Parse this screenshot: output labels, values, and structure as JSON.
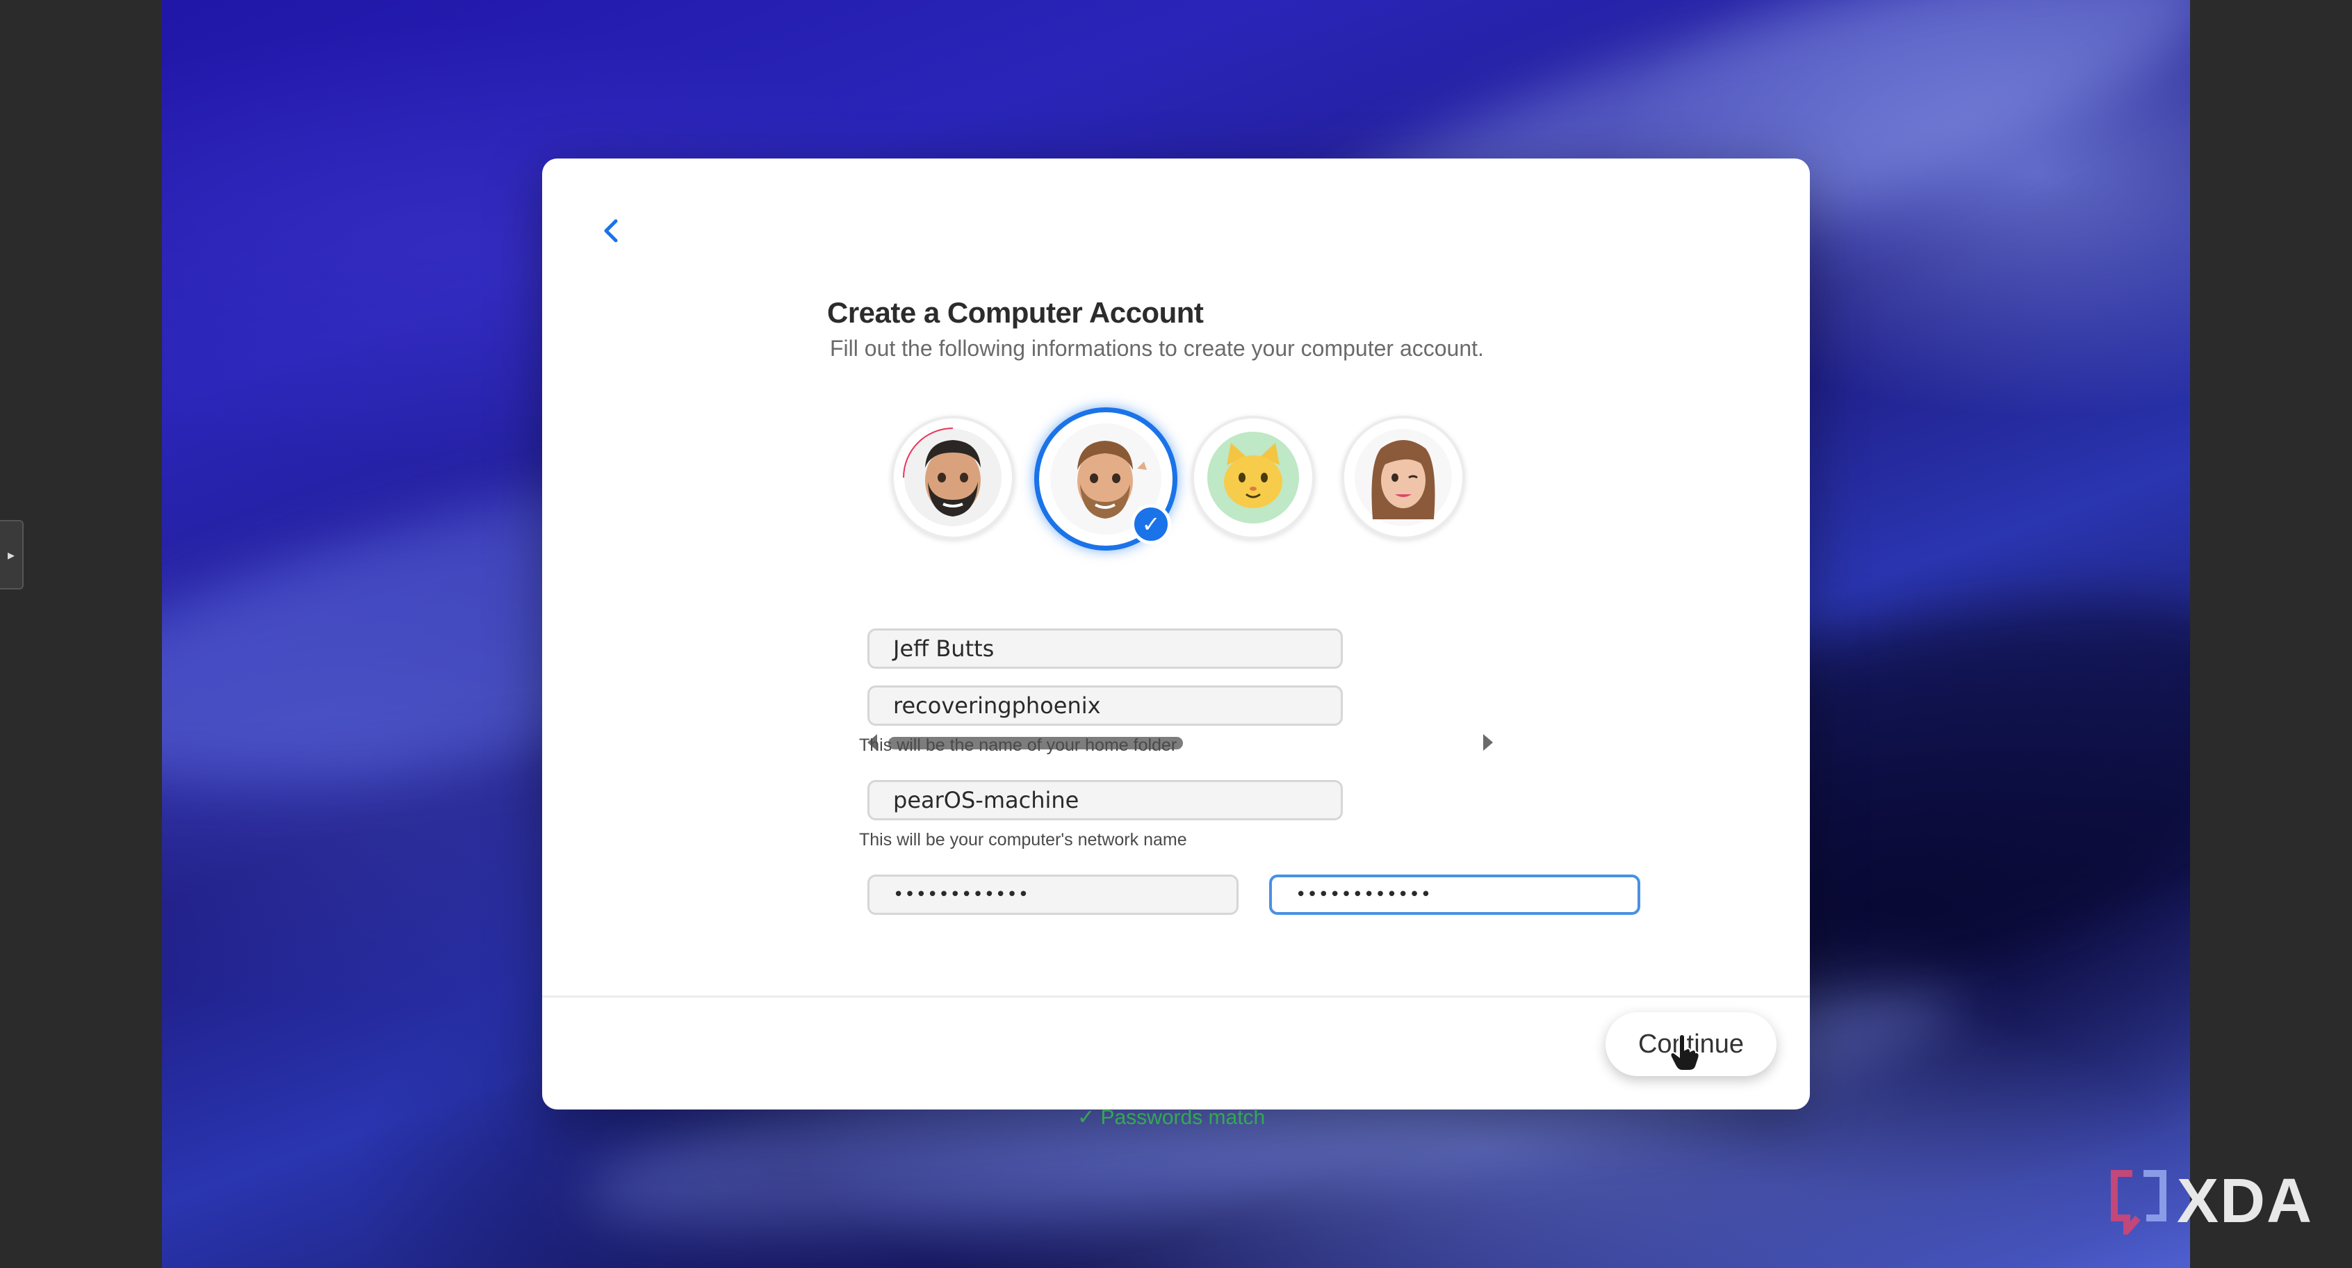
{
  "dialog": {
    "title": "Create a Computer Account",
    "subtitle": "Fill out the following informations to create your computer account."
  },
  "avatars": [
    {
      "name": "bearded-man-memoji",
      "selected": false
    },
    {
      "name": "ginger-man-memoji",
      "selected": true
    },
    {
      "name": "cat-memoji",
      "selected": false
    },
    {
      "name": "woman-memoji",
      "selected": false
    }
  ],
  "form": {
    "full_name": "Jeff Butts",
    "account_name": "recoveringphoenix",
    "account_name_hint": "This will be the name of your home folder",
    "computer_name": "pearOS-machine",
    "computer_name_hint": "This will be your computer's network name",
    "password": "••••••••••••",
    "password_confirm": "••••••••••••",
    "password_status": "✓ Passwords match"
  },
  "footer": {
    "continue_label": "Continue"
  },
  "watermark": {
    "text": "XDA"
  },
  "colors": {
    "accent": "#1a73e8",
    "success": "#34a853"
  }
}
